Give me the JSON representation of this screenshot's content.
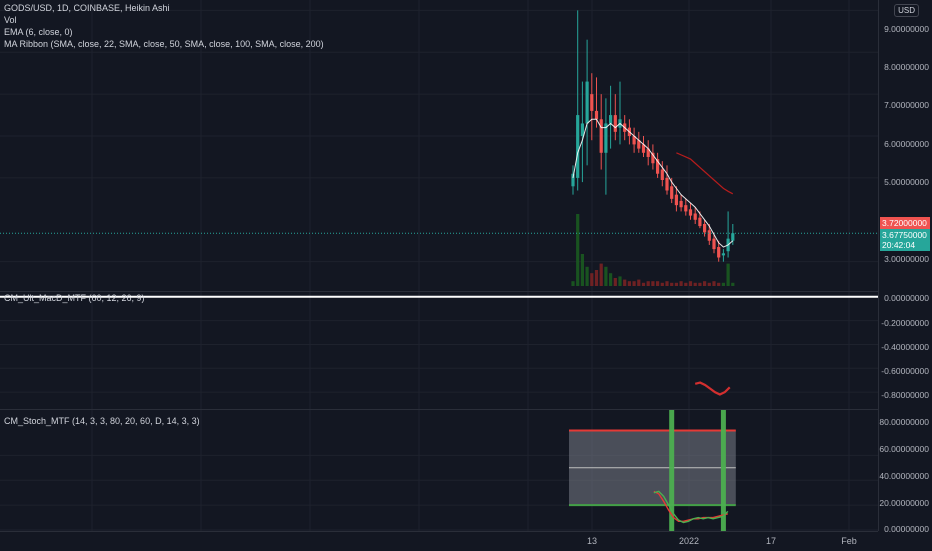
{
  "legend": {
    "title": "GODS/USD, 1D, COINBASE, Heikin Ashi",
    "vol": "Vol",
    "ema": "EMA (6, close, 0)",
    "ma_ribbon": "MA Ribbon (SMA, close, 22, SMA, close, 50, SMA, close, 100, SMA, close, 200)",
    "macd": "CM_Ult_MacD_MTF (60, 12, 26, 9)",
    "stoch": "CM_Stoch_MTF (14, 3, 3, 80, 20, 60, D, 14, 3, 3)"
  },
  "price_axis": {
    "currency": "USD",
    "main_ticks": [
      "9.00000000",
      "8.00000000",
      "7.00000000",
      "6.00000000",
      "5.00000000",
      "3.00000000"
    ],
    "macd_ticks": [
      "0.00000000",
      "-0.20000000",
      "-0.40000000",
      "-0.60000000",
      "-0.80000000"
    ],
    "stoch_ticks": [
      "80.00000000",
      "60.00000000",
      "40.00000000",
      "20.00000000",
      "0.00000000"
    ],
    "badge_high": "3.72000000",
    "badge_last": "3.67750000",
    "badge_countdown": "20:42:04"
  },
  "time_axis": {
    "labels": [
      "13",
      "2022",
      "17",
      "Feb"
    ]
  },
  "colors": {
    "up": "#26a69a",
    "down": "#ef5350",
    "bg": "#131722",
    "ema": "#ffffff",
    "ribbon": "#b71c1c"
  },
  "chart_data": {
    "type": "candlestick",
    "main_yrange": [
      2.3,
      9.2
    ],
    "candles": [
      {
        "o": 4.8,
        "h": 5.3,
        "l": 4.6,
        "c": 5.1
      },
      {
        "o": 5.0,
        "h": 9.0,
        "l": 4.7,
        "c": 6.5
      },
      {
        "o": 6.0,
        "h": 7.3,
        "l": 4.9,
        "c": 6.3
      },
      {
        "o": 6.3,
        "h": 8.3,
        "l": 5.3,
        "c": 7.3
      },
      {
        "o": 7.0,
        "h": 7.5,
        "l": 5.9,
        "c": 6.6
      },
      {
        "o": 6.6,
        "h": 7.4,
        "l": 6.2,
        "c": 6.4
      },
      {
        "o": 6.4,
        "h": 7.0,
        "l": 5.2,
        "c": 5.6
      },
      {
        "o": 5.6,
        "h": 6.9,
        "l": 4.6,
        "c": 6.3
      },
      {
        "o": 6.3,
        "h": 7.2,
        "l": 5.7,
        "c": 6.5
      },
      {
        "o": 6.5,
        "h": 7.0,
        "l": 5.9,
        "c": 6.1
      },
      {
        "o": 6.2,
        "h": 7.3,
        "l": 5.8,
        "c": 6.4
      },
      {
        "o": 6.3,
        "h": 6.5,
        "l": 5.9,
        "c": 6.1
      },
      {
        "o": 6.2,
        "h": 6.4,
        "l": 5.8,
        "c": 6.0
      },
      {
        "o": 6.0,
        "h": 6.2,
        "l": 5.6,
        "c": 5.8
      },
      {
        "o": 5.9,
        "h": 6.1,
        "l": 5.6,
        "c": 5.7
      },
      {
        "o": 5.8,
        "h": 6.0,
        "l": 5.5,
        "c": 5.6
      },
      {
        "o": 5.7,
        "h": 5.9,
        "l": 5.3,
        "c": 5.5
      },
      {
        "o": 5.6,
        "h": 5.8,
        "l": 5.2,
        "c": 5.35
      },
      {
        "o": 5.45,
        "h": 5.6,
        "l": 5.0,
        "c": 5.1
      },
      {
        "o": 5.2,
        "h": 5.4,
        "l": 4.8,
        "c": 4.95
      },
      {
        "o": 5.0,
        "h": 5.3,
        "l": 4.6,
        "c": 4.7
      },
      {
        "o": 4.8,
        "h": 5.0,
        "l": 4.4,
        "c": 4.5
      },
      {
        "o": 4.6,
        "h": 4.8,
        "l": 4.2,
        "c": 4.35
      },
      {
        "o": 4.45,
        "h": 4.6,
        "l": 4.2,
        "c": 4.3
      },
      {
        "o": 4.35,
        "h": 4.5,
        "l": 4.1,
        "c": 4.2
      },
      {
        "o": 4.25,
        "h": 4.4,
        "l": 4.0,
        "c": 4.1
      },
      {
        "o": 4.15,
        "h": 4.3,
        "l": 3.9,
        "c": 4.0
      },
      {
        "o": 4.05,
        "h": 4.2,
        "l": 3.8,
        "c": 3.85
      },
      {
        "o": 3.9,
        "h": 4.0,
        "l": 3.6,
        "c": 3.7
      },
      {
        "o": 3.75,
        "h": 3.9,
        "l": 3.4,
        "c": 3.5
      },
      {
        "o": 3.55,
        "h": 3.7,
        "l": 3.2,
        "c": 3.3
      },
      {
        "o": 3.35,
        "h": 3.5,
        "l": 3.0,
        "c": 3.1
      },
      {
        "o": 3.15,
        "h": 3.3,
        "l": 3.0,
        "c": 3.2
      },
      {
        "o": 3.25,
        "h": 4.2,
        "l": 3.1,
        "c": 3.55
      },
      {
        "o": 3.5,
        "h": 3.9,
        "l": 3.4,
        "c": 3.68
      }
    ],
    "volumes": [
      3,
      45,
      20,
      12,
      8,
      10,
      14,
      12,
      8,
      5,
      6,
      4,
      3,
      3,
      4,
      2,
      3,
      3,
      3,
      2,
      3,
      2,
      2,
      3,
      2,
      3,
      2,
      2,
      3,
      2,
      3,
      2,
      2,
      14,
      2
    ],
    "ema": [
      5.0,
      5.6,
      5.9,
      6.3,
      6.4,
      6.4,
      6.2,
      6.2,
      6.3,
      6.2,
      6.3,
      6.2,
      6.1,
      6.0,
      5.9,
      5.8,
      5.7,
      5.55,
      5.4,
      5.25,
      5.1,
      4.9,
      4.75,
      4.6,
      4.5,
      4.4,
      4.3,
      4.15,
      4.0,
      3.85,
      3.65,
      3.45,
      3.35,
      3.4,
      3.5
    ],
    "ribbon_ma22": [
      5.6,
      5.55,
      5.5,
      5.45,
      5.35,
      5.25,
      5.15,
      5.05,
      4.95,
      4.85,
      4.75,
      4.68,
      4.62
    ],
    "macd_yrange": [
      -0.95,
      0.04
    ],
    "macd_line": [
      -0.73,
      -0.72,
      -0.74,
      -0.77,
      -0.8,
      -0.82,
      -0.8,
      -0.76
    ],
    "stoch_yrange": [
      0,
      90
    ],
    "stoch_upper": 80,
    "stoch_lower": 20,
    "stoch_mid": 50,
    "stoch_k": [
      30,
      31,
      27,
      20,
      13,
      8,
      6,
      7,
      9,
      10,
      9,
      10,
      9,
      10,
      11,
      15
    ],
    "stoch_d": [
      31,
      29,
      23,
      16,
      10,
      7,
      7,
      8,
      9,
      9,
      10,
      10,
      10,
      11,
      12,
      13
    ],
    "stoch_cross_bars": [
      21,
      32
    ]
  }
}
